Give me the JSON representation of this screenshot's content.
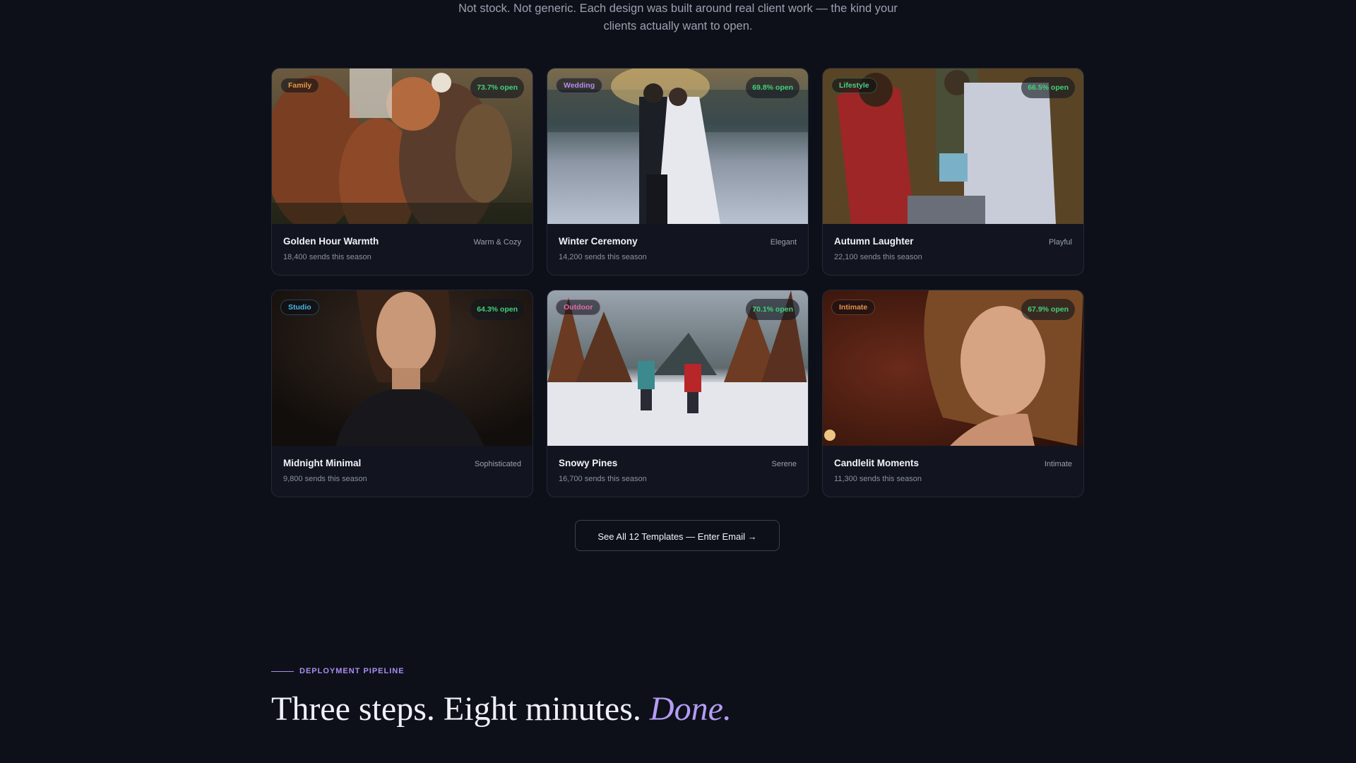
{
  "intro": {
    "line1": "Not stock. Not generic. Each design was built around real client work — the kind your",
    "line2": "clients actually want to open."
  },
  "templates": [
    {
      "tag": "Family",
      "tag_color": "#e39a4a",
      "open_rate": "73.7% open",
      "title": "Golden Hour Warmth",
      "mood": "Warm & Cozy",
      "sends": "18,400 sends this season",
      "image": "family-golden-hour-photo"
    },
    {
      "tag": "Wedding",
      "tag_color": "#b48cf2",
      "open_rate": "69.8% open",
      "title": "Winter Ceremony",
      "mood": "Elegant",
      "sends": "14,200 sends this season",
      "image": "winter-wedding-photo"
    },
    {
      "tag": "Lifestyle",
      "tag_color": "#4ad18a",
      "open_rate": "66.5% open",
      "title": "Autumn Laughter",
      "mood": "Playful",
      "sends": "22,100 sends this season",
      "image": "autumn-family-photo"
    },
    {
      "tag": "Studio",
      "tag_color": "#4ab6e8",
      "open_rate": "64.3% open",
      "title": "Midnight Minimal",
      "mood": "Sophisticated",
      "sends": "9,800 sends this season",
      "image": "studio-portrait-photo"
    },
    {
      "tag": "Outdoor",
      "tag_color": "#e86aa8",
      "open_rate": "70.1% open",
      "title": "Snowy Pines",
      "mood": "Serene",
      "sends": "16,700 sends this season",
      "image": "snowy-pines-couple-photo"
    },
    {
      "tag": "Intimate",
      "tag_color": "#e8914a",
      "open_rate": "67.9% open",
      "title": "Candlelit Moments",
      "mood": "Intimate",
      "sends": "11,300 sends this season",
      "image": "candlelit-portrait-photo"
    }
  ],
  "cta": {
    "label": "See All 12 Templates — Enter Email →"
  },
  "pipeline": {
    "label": "DEPLOYMENT PIPELINE",
    "headline_plain": "Three steps. Eight minutes.",
    "headline_accent": "Done."
  }
}
